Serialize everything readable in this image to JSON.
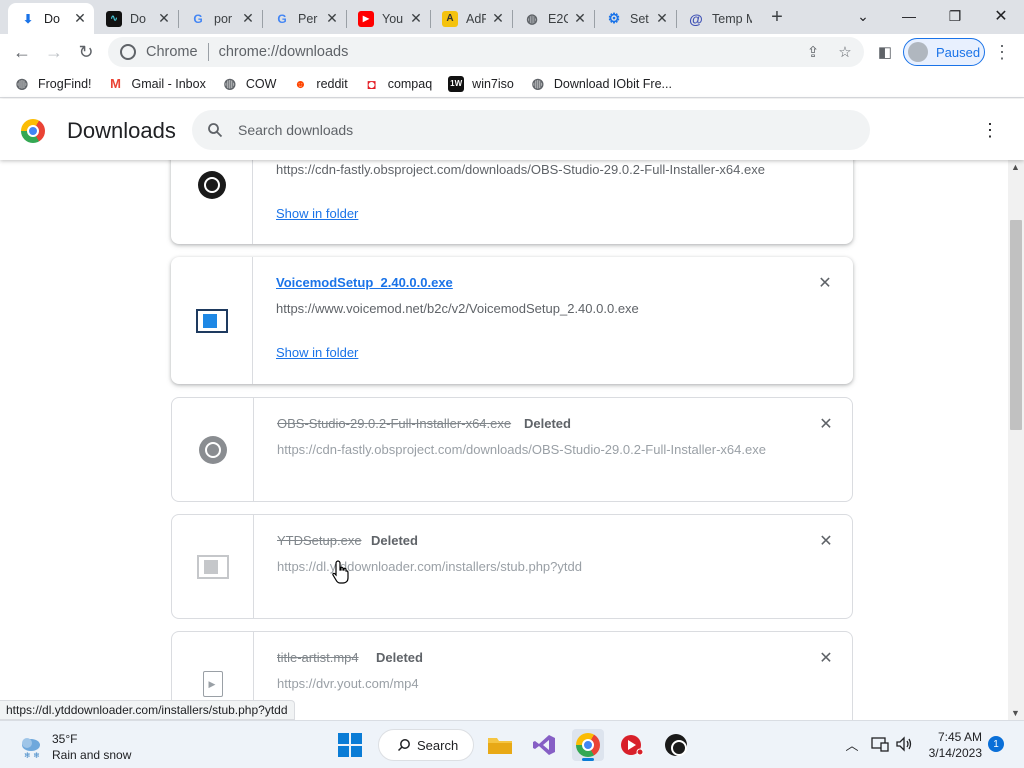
{
  "tabs": [
    {
      "title": "Do",
      "icon": "download-icon",
      "active": true
    },
    {
      "title": "Do",
      "icon": "wave-icon",
      "active": false
    },
    {
      "title": "por",
      "icon": "google-icon",
      "active": false
    },
    {
      "title": "Per",
      "icon": "google-icon",
      "active": false
    },
    {
      "title": "You",
      "icon": "youtube-icon",
      "active": false
    },
    {
      "title": "AdF",
      "icon": "adf-icon",
      "active": false
    },
    {
      "title": "E2C",
      "icon": "globe-icon",
      "active": false
    },
    {
      "title": "Set",
      "icon": "gear-icon",
      "active": false
    },
    {
      "title": "Temp M",
      "icon": "at-icon",
      "active": false
    }
  ],
  "toolbar": {
    "site_chip": "Chrome",
    "url": "chrome://downloads",
    "profile_label": "Paused"
  },
  "bookmarks": [
    {
      "label": "FrogFind!",
      "icon": "globe-icon"
    },
    {
      "label": "Gmail - Inbox",
      "icon": "gmail-icon"
    },
    {
      "label": "COW",
      "icon": "globe-icon"
    },
    {
      "label": "reddit",
      "icon": "reddit-icon"
    },
    {
      "label": "compaq",
      "icon": "compaq-icon"
    },
    {
      "label": "win7iso",
      "icon": "win7iso-icon"
    },
    {
      "label": "Download IObit Fre...",
      "icon": "globe-icon"
    }
  ],
  "downloads_page": {
    "title": "Downloads",
    "search_placeholder": "Search downloads"
  },
  "downloads": [
    {
      "filename": "",
      "url": "https://cdn-fastly.obsproject.com/downloads/OBS-Studio-29.0.2-Full-Installer-x64.exe",
      "action": "Show in folder",
      "status": "",
      "deleted": false,
      "icon": "obs-icon"
    },
    {
      "filename": "VoicemodSetup_2.40.0.0.exe",
      "url": "https://www.voicemod.net/b2c/v2/VoicemodSetup_2.40.0.0.exe",
      "action": "Show in folder",
      "status": "",
      "deleted": false,
      "icon": "installer-icon"
    },
    {
      "filename": "OBS-Studio-29.0.2-Full-Installer-x64.exe",
      "url": "https://cdn-fastly.obsproject.com/downloads/OBS-Studio-29.0.2-Full-Installer-x64.exe",
      "action": "",
      "status": "Deleted",
      "deleted": true,
      "icon": "obs-icon"
    },
    {
      "filename": "YTDSetup.exe",
      "url": "https://dl.ytddownloader.com/installers/stub.php?ytdd",
      "action": "",
      "status": "Deleted",
      "deleted": true,
      "icon": "installer-icon"
    },
    {
      "filename": "title-artist.mp4",
      "url": "https://dvr.yout.com/mp4",
      "action": "",
      "status": "Deleted",
      "deleted": true,
      "icon": "video-file-icon"
    }
  ],
  "status_bubble": "https://dl.ytddownloader.com/installers/stub.php?ytdd",
  "taskbar": {
    "weather_temp": "35°F",
    "weather_desc": "Rain and snow",
    "search_label": "Search",
    "time": "7:45 AM",
    "date": "3/14/2023",
    "notification_count": "1"
  },
  "colors": {
    "accent": "#1a73e8",
    "taskbar_bg": "#eef3f9",
    "tabstrip_bg": "#dee1e6"
  }
}
